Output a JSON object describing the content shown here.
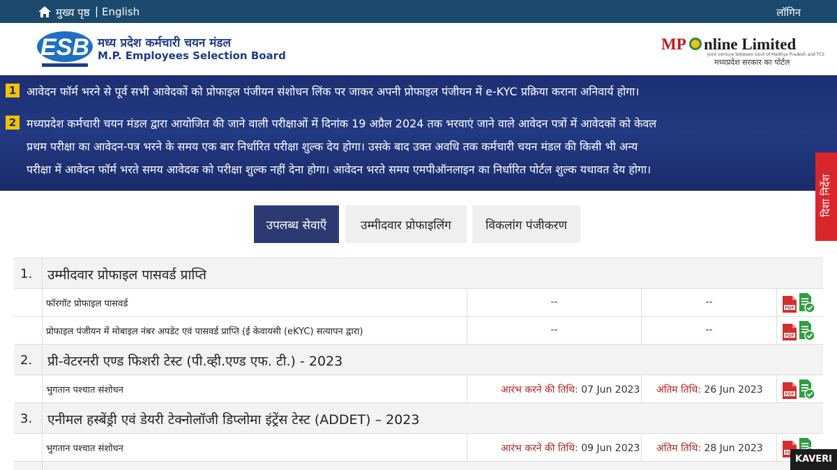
{
  "topbar": {
    "home_label": "मुख्य पृष्ठ",
    "separator": "|",
    "english_label": "English",
    "login_label": "लॉगिन"
  },
  "header": {
    "esb_title_hi": "मध्य प्रदेश कर्मचारी चयन मंडल",
    "esb_title_en": "M.P. Employees Selection Board",
    "esb_logo_text": "ESB",
    "mponline_mark": "MP",
    "mponline_name": "nline Limited",
    "mponline_tagline": "Joint venture between Govt of Madhya Pradesh and TCS",
    "mponline_portal_hi": "मध्यप्रदेश सरकार का पोर्टल"
  },
  "banner": {
    "notices": [
      {
        "num": "1",
        "lines": [
          "आवेदन फॉर्म भरने से पूर्व सभी आवेदकों को प्रोफाइल पंजीयन संशोधन लिंक पर जाकर अपनी प्रोफाइल पंजीयन में  e-KYC प्रक्रिया कराना अनिवार्य होगा।"
        ]
      },
      {
        "num": "2",
        "lines": [
          "मध्यप्रदेश कर्मचारी चयन मंडल द्वारा आयोजित की जाने वाली परीक्षाओं में दिनांक 19 अप्रैल 2024 तक भरवाएं जाने वाले आवेदन पत्रों में आवेदकों को केवल",
          "प्रथम परीक्षा का आवेदन-पत्र  भरने के समय एक बार निर्धारित परीक्षा शुल्क देय होगा। उसके बाद उक्त अवधि तक कर्मचारी चयन मंडल की किसी भी अन्य",
          "परीक्षा में आवेदन फॉर्म भरते समय आवेदक को परीक्षा शुल्क नहीं देना होगा। आवेदन भरते समय एमपीऑनलाइन का निर्धारित पोर्टल शुल्क यथावत देय होगा।"
        ]
      }
    ]
  },
  "sidetab": {
    "label": "दिशा निर्देश"
  },
  "tabs": [
    {
      "label": "उपलब्ध सेवाएँ",
      "active": true
    },
    {
      "label": "उम्मीदवार प्रोफाइलिंग",
      "active": false
    },
    {
      "label": "विकलांग पंजीकरण",
      "active": false
    }
  ],
  "sections": [
    {
      "index": "1.",
      "title": "उम्मीदवार प्रोफाइल पासवर्ड प्राप्ति",
      "rows": [
        {
          "label": "फॉरगॉट प्रोफाइल पासवर्ड",
          "start": "--",
          "end": "--"
        },
        {
          "label": "प्रोफाइल पंजीयन में मोबाइल नंबर अपडेट एवं पासवर्ड प्राप्ति (ई केवायसी (eKYC) सत्यापन द्वारा)",
          "start": "--",
          "end": "--"
        }
      ]
    },
    {
      "index": "2.",
      "title": "प्री-वेटरनरी एण्ड फिशरी टेस्ट (पी.व्ही.एण्ड एफ. टी.) - 2023",
      "rows": [
        {
          "label": "भुगतान पश्चात संशोधन",
          "start_label": "आरंभ करने की तिथि:",
          "start": "07 Jun 2023",
          "end_label": "अंतिम तिथि:",
          "end": "26 Jun 2023"
        }
      ]
    },
    {
      "index": "3.",
      "title": "एनीमल हस्बेंड्री एवं डेयरी टेक्नोलॉजी डिप्लोमा इंट्रेंस टेस्ट (ADDET) – 2023",
      "rows": [
        {
          "label": "भुगतान पश्चात संशोधन",
          "start_label": "आरंभ करने की तिथि:",
          "start": "09 Jun 2023",
          "end_label": "अंतिम तिथि:",
          "end": "28 Jun 2023"
        }
      ]
    }
  ],
  "icons": {
    "home": "home-icon",
    "pdf": "pdf-icon",
    "check": "document-check-icon"
  },
  "colors": {
    "topbar": "#1c4a6e",
    "banner": "#1d2f72",
    "active_tab": "#2b3a70",
    "sidetab": "#d9262b",
    "date_label": "#b22222",
    "pdf": "#d32f2f",
    "check": "#2e9e3f"
  },
  "watermark": "KAVERI"
}
